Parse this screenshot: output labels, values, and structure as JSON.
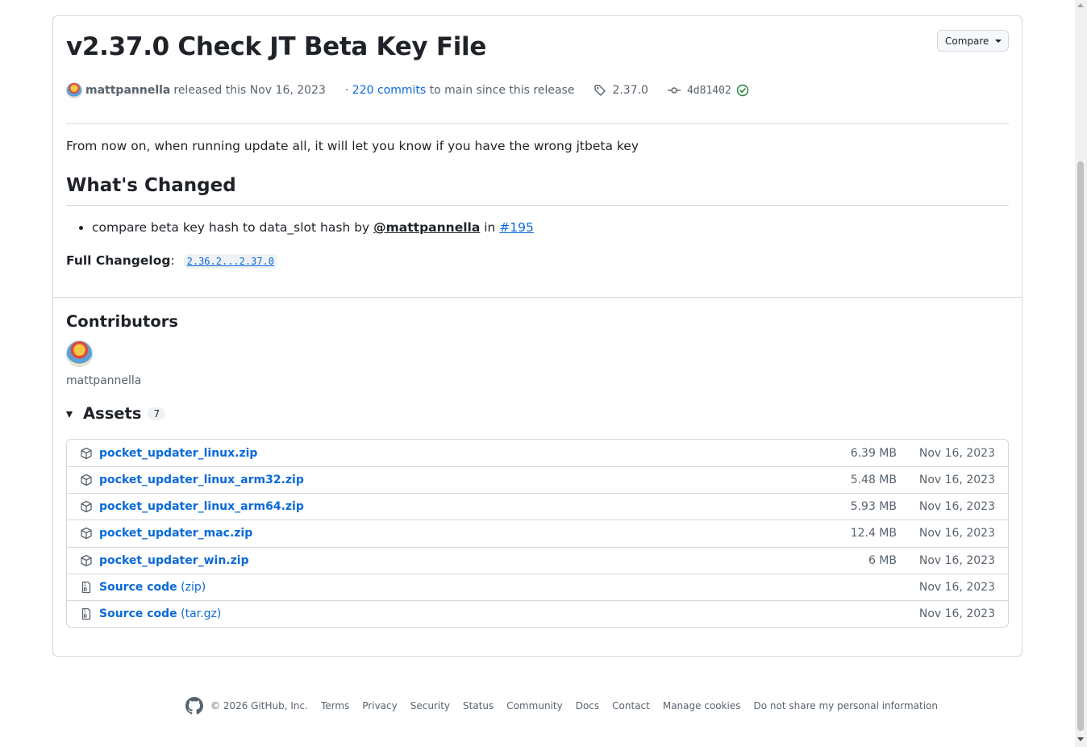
{
  "release": {
    "title": "v2.37.0 Check JT Beta Key File",
    "compare_label": "Compare",
    "author": "mattpannella",
    "released_text": "released this Nov 16, 2023",
    "commits_prefix": "· ",
    "commits_link": "220 commits",
    "commits_suffix": " to main since this release",
    "tag": "2.37.0",
    "sha": "4d81402",
    "description": "From now on, when running update all, it will let you know if you have the wrong jtbeta key",
    "whats_changed_heading": "What's Changed",
    "change_item": {
      "text": "compare beta key hash to data_slot hash by ",
      "mention": "@mattpannella",
      "in_text": " in ",
      "issue": "#195"
    },
    "changelog_label": "Full Changelog",
    "changelog_colon": ":",
    "changelog_range": "2.36.2...2.37.0"
  },
  "contributors": {
    "heading": "Contributors",
    "names": [
      "mattpannella"
    ]
  },
  "assets": {
    "heading": "Assets",
    "count": "7",
    "items": [
      {
        "name": "pocket_updater_linux.zip",
        "suffix": "",
        "size": "6.39 MB",
        "date": "Nov 16, 2023",
        "icon": "package-icon"
      },
      {
        "name": "pocket_updater_linux_arm32.zip",
        "suffix": "",
        "size": "5.48 MB",
        "date": "Nov 16, 2023",
        "icon": "package-icon"
      },
      {
        "name": "pocket_updater_linux_arm64.zip",
        "suffix": "",
        "size": "5.93 MB",
        "date": "Nov 16, 2023",
        "icon": "package-icon"
      },
      {
        "name": "pocket_updater_mac.zip",
        "suffix": "",
        "size": "12.4 MB",
        "date": "Nov 16, 2023",
        "icon": "package-icon"
      },
      {
        "name": "pocket_updater_win.zip",
        "suffix": "",
        "size": "6 MB",
        "date": "Nov 16, 2023",
        "icon": "package-icon"
      },
      {
        "name": "Source code",
        "suffix": " (zip)",
        "size": "",
        "date": "Nov 16, 2023",
        "icon": "file-zip-icon"
      },
      {
        "name": "Source code",
        "suffix": " (tar.gz)",
        "size": "",
        "date": "Nov 16, 2023",
        "icon": "file-zip-icon"
      }
    ]
  },
  "footer": {
    "copyright": "© 2026 GitHub, Inc.",
    "links": [
      "Terms",
      "Privacy",
      "Security",
      "Status",
      "Community",
      "Docs",
      "Contact",
      "Manage cookies",
      "Do not share my personal information"
    ]
  },
  "colors": {
    "link": "#0969da",
    "muted": "#59636e",
    "border": "#d1d9e0",
    "success": "#1a7f37"
  }
}
